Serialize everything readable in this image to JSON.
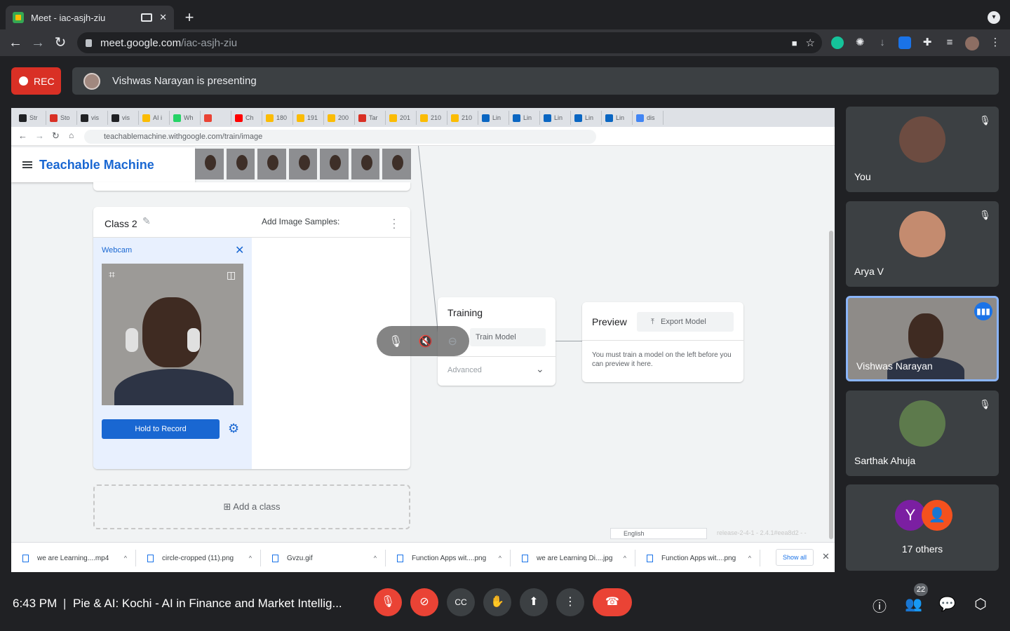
{
  "browser": {
    "tab_title": "Meet - iac-asjh-ziu",
    "url_host": "meet.google.com",
    "url_path": "/iac-asjh-ziu"
  },
  "meet": {
    "rec_label": "REC",
    "presenting_text": "Vishwas Narayan is presenting",
    "time": "6:43 PM",
    "separator": "|",
    "meeting_title": "Pie & AI: Kochi - AI in Finance and Market Intellig...",
    "people_count": "22",
    "participants": [
      {
        "name": "You"
      },
      {
        "name": "Arya V"
      },
      {
        "name": "Vishwas Narayan"
      },
      {
        "name": "Sarthak Ahuja"
      }
    ],
    "others": {
      "label": "17 others",
      "avatar_letter": "Y"
    }
  },
  "shared": {
    "tabs": [
      "Str",
      "Sto",
      "vis",
      "vis",
      "AI i",
      "Wh",
      "",
      "Ch",
      "180",
      "191",
      "200",
      "Tar",
      "201",
      "210",
      "210",
      "Lin",
      "Lin",
      "Lin",
      "Lin",
      "Lin",
      "dis"
    ],
    "url": "teachablemachine.withgoogle.com/train/image",
    "app_title": "Teachable Machine",
    "class_title": "Class 2",
    "webcam_label": "Webcam",
    "add_samples": "Add Image Samples:",
    "hold_record": "Hold to Record",
    "add_class": "Add a class",
    "training_title": "Training",
    "train_model": "Train Model",
    "advanced": "Advanced",
    "preview_title": "Preview",
    "export_model": "Export Model",
    "preview_msg": "You must train a model on the left before you can preview it here.",
    "language": "English",
    "release": "release-2-4-1 - 2.4.1#eea8d2 - -",
    "downloads": [
      "we are Learning....mp4",
      "circle-cropped (11).png",
      "Gvzu.gif",
      "Function Apps wit....png",
      "we are Learning Di....jpg",
      "Function Apps wit....png"
    ],
    "show_all": "Show all"
  }
}
